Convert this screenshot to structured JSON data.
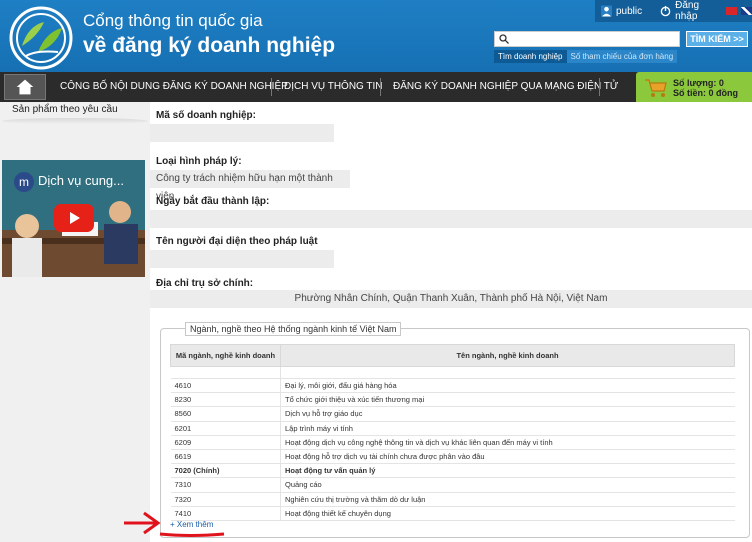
{
  "header": {
    "title_line1": "Cổng thông tin quốc gia",
    "title_line2": "về đăng ký doanh nghiệp",
    "user": "public",
    "login": "Đăng nhập",
    "search_button": "TÌM KIẾM >>",
    "search_tabs": [
      "Tìm doanh nghiệp",
      "Số tham chiếu của đơn hàng"
    ]
  },
  "nav": {
    "items": [
      "CÔNG BỐ NỘI DUNG ĐĂNG KÝ DOANH NGHIỆP",
      "DỊCH VỤ THÔNG TIN",
      "ĐĂNG KÝ DOANH NGHIỆP QUA MẠNG ĐIỆN TỬ"
    ]
  },
  "cart": {
    "quantity": "Số lượng: 0",
    "amount": "Số tiền: 0 đồng"
  },
  "sidebar": {
    "link": "Sản phẩm theo yêu cầu",
    "video_title": "Dịch vụ cung..."
  },
  "company": {
    "tax_code_label": "Mã số doanh nghiệp:",
    "type_label": "Loại hình pháp lý:",
    "type_value": "Công ty trách nhiệm hữu hạn một thành viên",
    "start_date_label": "Ngày bắt đầu thành lập:",
    "representative_label": "Tên người đại diện theo pháp luật",
    "address_label": "Địa chỉ trụ sở chính:",
    "address_value": "Phường Nhân Chính, Quận Thanh Xuân, Thành phố Hà Nội, Việt Nam"
  },
  "industries": {
    "legend": "Ngành, nghề theo Hệ thống ngành kinh tế Việt Nam",
    "col_code": "Mã ngành, nghề kinh doanh",
    "col_name": "Tên ngành, nghề kinh doanh",
    "rows": [
      {
        "code": "4610",
        "name": "Đại lý, môi giới, đấu giá hàng hóa",
        "bold": false
      },
      {
        "code": "8230",
        "name": "Tổ chức giới thiệu và xúc tiến thương mại",
        "bold": false
      },
      {
        "code": "8560",
        "name": "Dịch vụ hỗ trợ giáo dục",
        "bold": false
      },
      {
        "code": "6201",
        "name": "Lập trình máy vi tính",
        "bold": false
      },
      {
        "code": "6209",
        "name": "Hoạt động dịch vụ công nghệ thông tin và dịch vụ khác liên quan đến máy vi tính",
        "bold": false
      },
      {
        "code": "6619",
        "name": "Hoạt động hỗ trợ dịch vụ tài chính chưa được phân vào đâu",
        "bold": false
      },
      {
        "code": "7020 (Chính)",
        "name": "Hoạt động tư vấn quản lý",
        "bold": true
      },
      {
        "code": "7310",
        "name": "Quảng cáo",
        "bold": false
      },
      {
        "code": "7320",
        "name": "Nghiên cứu thị trường và thăm dò dư luận",
        "bold": false
      },
      {
        "code": "7410",
        "name": "Hoạt động thiết kế chuyên dụng",
        "bold": false
      }
    ],
    "more_link": "+ Xem thêm"
  }
}
